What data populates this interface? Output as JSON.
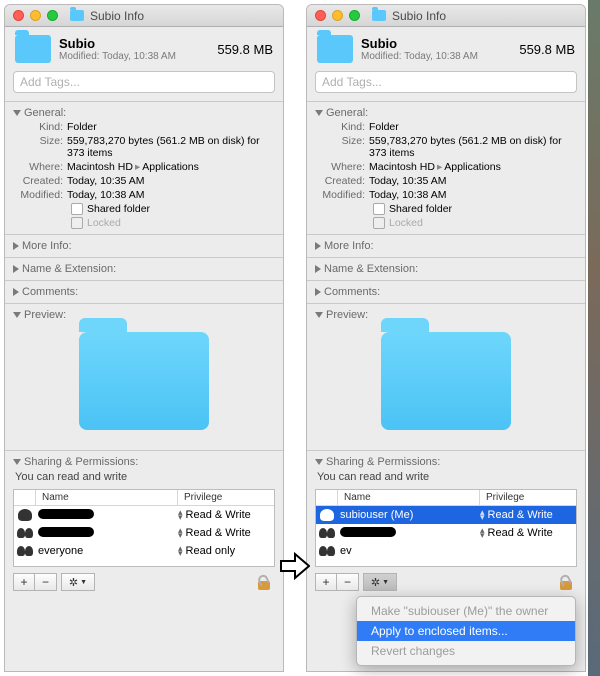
{
  "window": {
    "title": "Subio Info"
  },
  "header": {
    "name": "Subio",
    "modified": "Modified: Today, 10:38 AM",
    "size": "559.8 MB"
  },
  "tags": {
    "placeholder": "Add Tags..."
  },
  "sections": {
    "general": "General:",
    "moreinfo": "More Info:",
    "nameext": "Name & Extension:",
    "comments": "Comments:",
    "preview": "Preview:",
    "sharing": "Sharing & Permissions:"
  },
  "general": {
    "kind_label": "Kind:",
    "kind_value": "Folder",
    "size_label": "Size:",
    "size_value": "559,783,270 bytes (561.2 MB on disk) for 373 items",
    "where_label": "Where:",
    "where_part1": "Macintosh HD",
    "where_part2": "Applications",
    "created_label": "Created:",
    "created_value": "Today, 10:35 AM",
    "modified_label": "Modified:",
    "modified_value": "Today, 10:38 AM",
    "shared_folder": "Shared folder",
    "locked": "Locked"
  },
  "permissions": {
    "note": "You can read and write",
    "headers": {
      "name": "Name",
      "privilege": "Privilege"
    },
    "left_rows": [
      {
        "name_type": "redacted",
        "name": "",
        "priv": "Read & Write"
      },
      {
        "name_type": "redacted",
        "name": "",
        "priv": "Read & Write"
      },
      {
        "name_type": "text",
        "name": "everyone",
        "priv": "Read only"
      }
    ],
    "right_rows": [
      {
        "name_type": "text",
        "name": "subiouser (Me)",
        "priv": "Read & Write",
        "selected": true
      },
      {
        "name_type": "redacted",
        "name": "",
        "priv": "Read & Write"
      },
      {
        "name_type": "partial",
        "prefix": "ev",
        "priv": ""
      }
    ]
  },
  "ctx_menu": {
    "item1": "Make \"subiouser (Me)\" the owner",
    "item2": "Apply to enclosed items...",
    "item3": "Revert changes"
  },
  "buttons": {
    "plus": "+",
    "minus": "−",
    "gear": "✻"
  }
}
